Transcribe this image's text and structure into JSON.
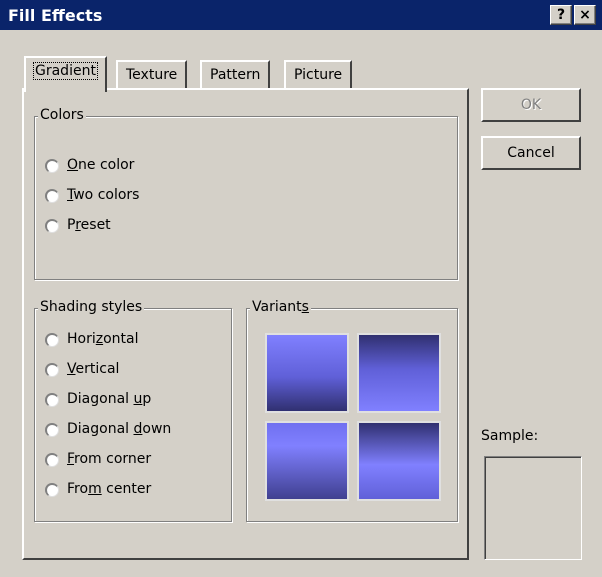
{
  "window": {
    "title": "Fill Effects",
    "help_label": "?",
    "close_label": "×"
  },
  "tabs": [
    {
      "label": "Gradient",
      "active": true
    },
    {
      "label": "Texture",
      "active": false
    },
    {
      "label": "Pattern",
      "active": false
    },
    {
      "label": "Picture",
      "active": false
    }
  ],
  "colors_group": {
    "legend": "Colors",
    "options": [
      {
        "pre": "",
        "key": "O",
        "post": "ne color",
        "selected": false
      },
      {
        "pre": "",
        "key": "T",
        "post": "wo colors",
        "selected": false
      },
      {
        "pre": "P",
        "key": "r",
        "post": "eset",
        "selected": false
      }
    ]
  },
  "shading_group": {
    "legend": "Shading styles",
    "options": [
      {
        "pre": "Hori",
        "key": "z",
        "post": "ontal",
        "selected": false
      },
      {
        "pre": "",
        "key": "V",
        "post": "ertical",
        "selected": false
      },
      {
        "pre": "Diagonal ",
        "key": "u",
        "post": "p",
        "selected": false
      },
      {
        "pre": "Diagonal ",
        "key": "d",
        "post": "own",
        "selected": false
      },
      {
        "pre": "",
        "key": "F",
        "post": "rom corner",
        "selected": false
      },
      {
        "pre": "Fro",
        "key": "m",
        "post": " center",
        "selected": false
      }
    ]
  },
  "variants_group": {
    "legend_pre": "Variant",
    "legend_key": "s",
    "legend_post": "",
    "swatch_colors": {
      "light": "#8080ff",
      "mid": "#6060d8",
      "dark": "#303070"
    }
  },
  "buttons": {
    "ok_label": "OK",
    "ok_enabled": false,
    "cancel_label": "Cancel"
  },
  "sample": {
    "label": "Sample:"
  }
}
